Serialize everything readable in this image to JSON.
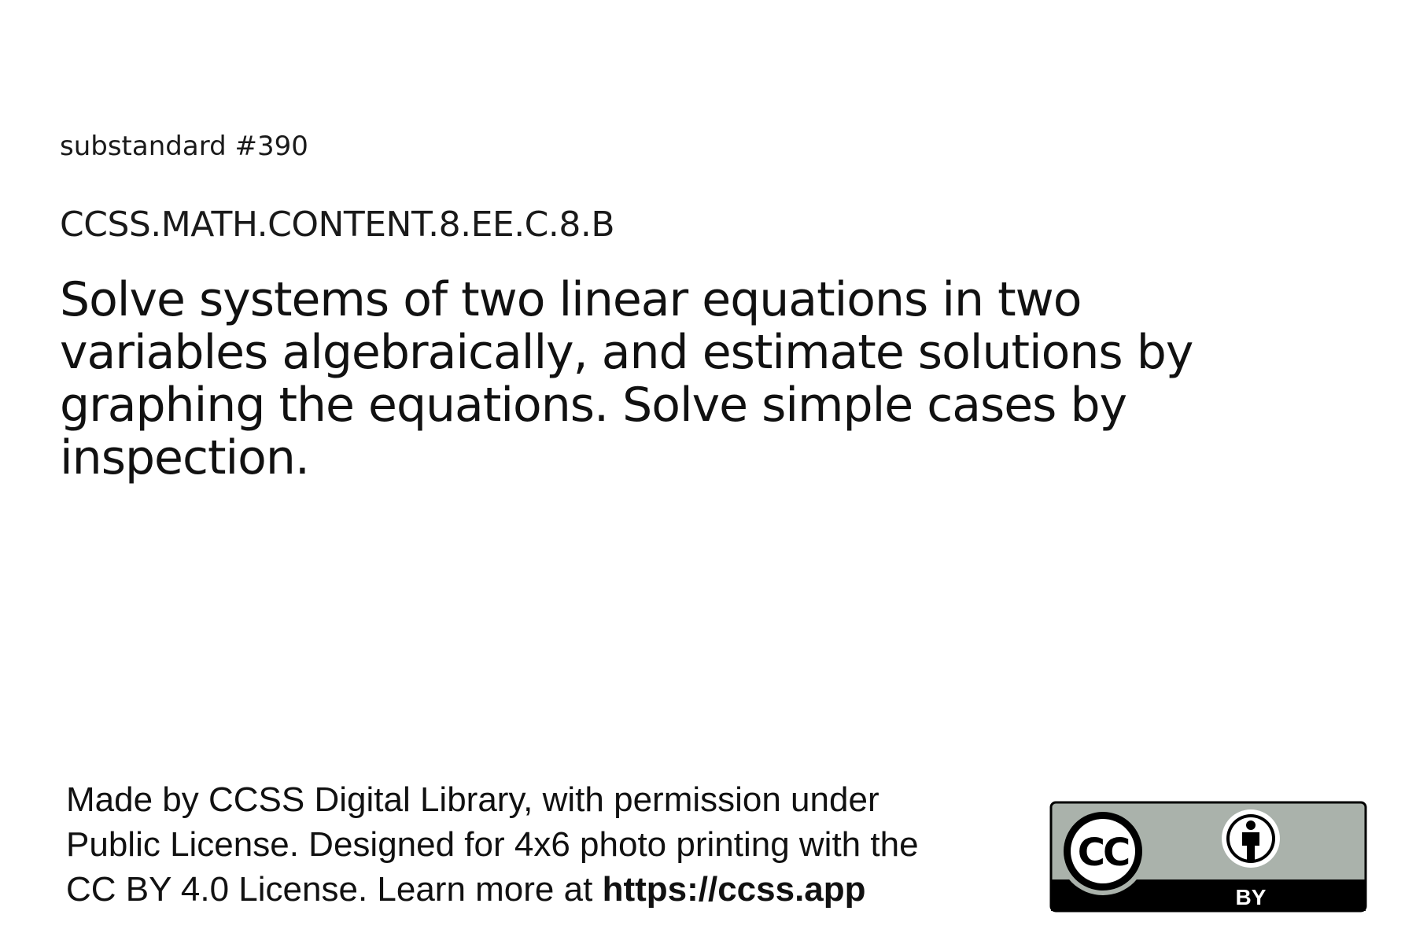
{
  "card": {
    "substandard": "substandard #390",
    "code": "CCSS.MATH.CONTENT.8.EE.C.8.B",
    "description": "Solve systems of two linear equations in two variables algebraically, and estimate solutions by graphing the equations. Solve simple cases by inspection."
  },
  "footer": {
    "line1": "Made by CCSS Digital Library, with permission under",
    "line2": "Public License. Designed for 4x6 photo printing with the",
    "line3_prefix": "CC BY 4.0 License. Learn more at ",
    "link": "https://ccss.app"
  },
  "badge": {
    "icon": "cc-by-license-icon",
    "cc_text": "CC",
    "by_text": "BY",
    "colors": {
      "panel": "#aab2ab",
      "border": "#000000",
      "band": "#000000",
      "text_light": "#ffffff"
    }
  }
}
